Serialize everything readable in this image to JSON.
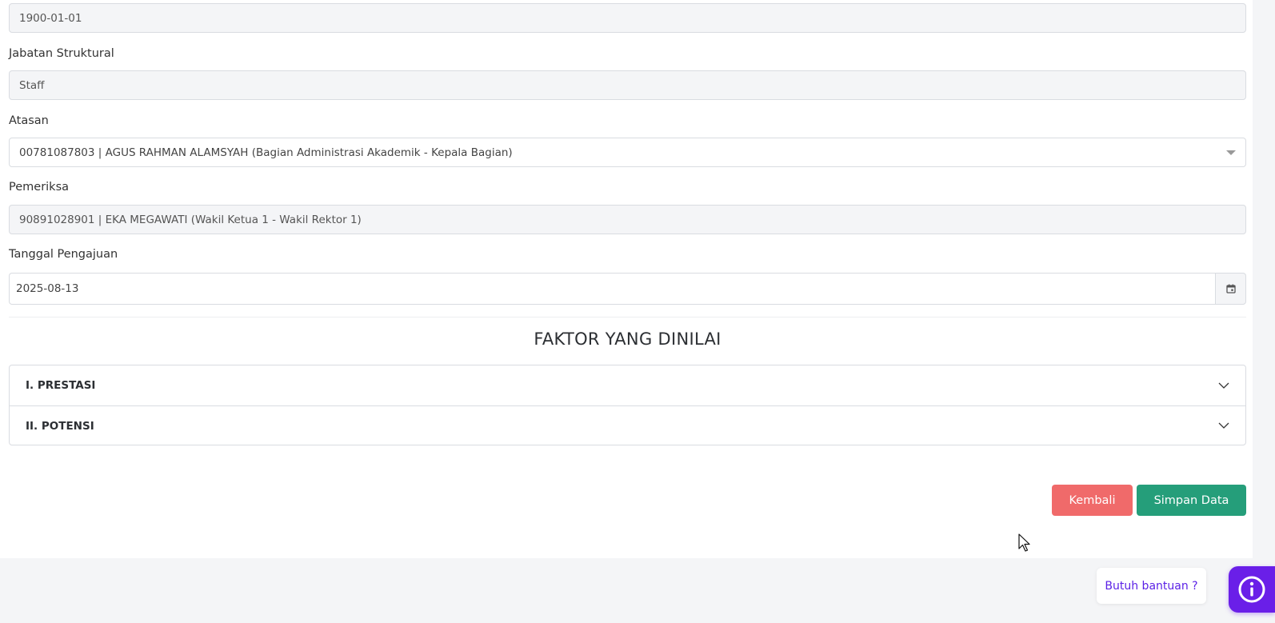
{
  "fields": {
    "first_value": "1900-01-01",
    "jabatan_label": "Jabatan Struktural",
    "jabatan_value": "Staff",
    "atasan_label": "Atasan",
    "atasan_value": "00781087803 | AGUS RAHMAN ALAMSYAH (Bagian Administrasi Akademik - Kepala Bagian)",
    "pemeriksa_label": "Pemeriksa",
    "pemeriksa_value": "90891028901 | EKA MEGAWATI (Wakil Ketua 1 - Wakil Rektor 1)",
    "tanggal_label": "Tanggal Pengajuan",
    "tanggal_value": "2025-08-13"
  },
  "section": {
    "title": "FAKTOR YANG DINILAI",
    "items": [
      {
        "label": "I. PRESTASI"
      },
      {
        "label": "II. POTENSI"
      }
    ]
  },
  "actions": {
    "back_label": "Kembali",
    "save_label": "Simpan Data"
  },
  "help": {
    "label": "Butuh bantuan ?"
  },
  "colors": {
    "back_button": "#f06a6a",
    "save_button": "#259e7a",
    "help_accent": "#6a1fe8"
  }
}
